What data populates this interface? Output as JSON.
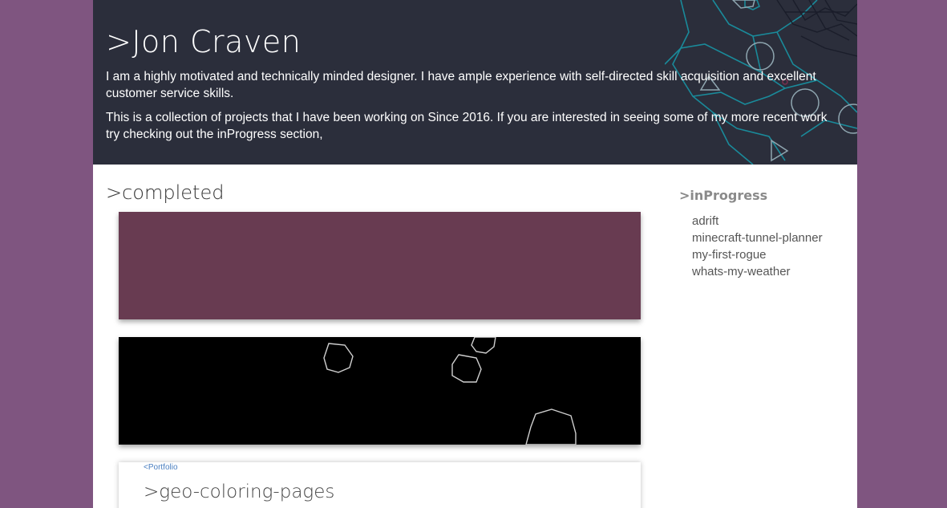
{
  "header": {
    "title": ">Jon Craven",
    "intro_1": "I am a highly motivated and technically minded designer. I have ample experience with self-directed skill acquisition and excellent customer service skills.",
    "intro_2": "This is a collection of projects that I have been working on Since 2016. If you are interested in seeing some of my more recent work try checking out the inProgress section,"
  },
  "completed": {
    "title": ">completed",
    "cards": [
      {
        "preview": "solid-color"
      },
      {
        "preview": "asteroids"
      },
      {
        "back_link": "<Portfolio",
        "title": ">geo-coloring-pages"
      }
    ]
  },
  "in_progress": {
    "title": ">inProgress",
    "items": [
      "adrift",
      "minecraft-tunnel-planner",
      "my-first-rogue",
      "whats-my-weather"
    ]
  },
  "colors": {
    "background": "#7f5580",
    "header": "#2b2e3b",
    "card_1": "#683b51",
    "accent_lines": "#1a8a9a",
    "link": "#4a7fc0"
  }
}
